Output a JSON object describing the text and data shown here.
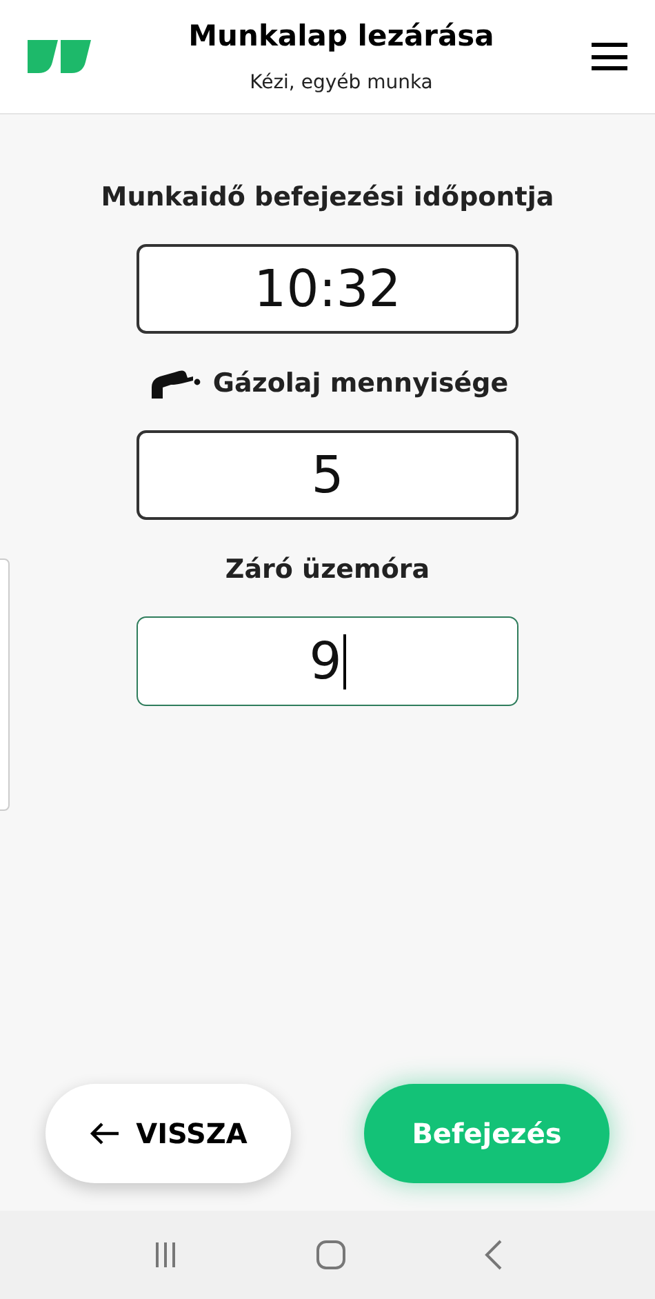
{
  "header": {
    "title": "Munkalap lezárása",
    "subtitle": "Kézi, egyéb munka"
  },
  "fields": [
    {
      "label": "Munkaidő befejezési időpontja",
      "value": "10:32",
      "kind": "plain",
      "focused": false
    },
    {
      "label": "Gázolaj mennyisége",
      "value": "5",
      "kind": "fuel",
      "focused": false
    },
    {
      "label": "Záró üzemóra",
      "value": "9",
      "kind": "plain",
      "focused": true
    }
  ],
  "buttons": [
    {
      "label": "VISSZA",
      "kind": "back"
    },
    {
      "label": "Befejezés",
      "kind": "primary"
    }
  ]
}
